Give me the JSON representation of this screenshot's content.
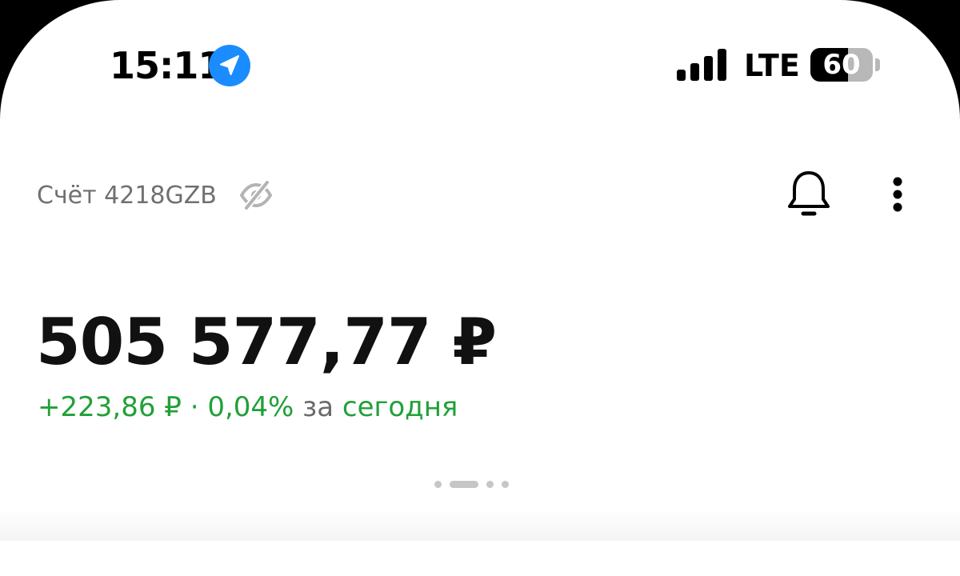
{
  "status_bar": {
    "time": "15:11",
    "network": "LTE",
    "battery_level": "60",
    "battery_fraction": 0.6,
    "location_icon": "location-arrow-icon",
    "signal_icon": "cellular-signal-icon"
  },
  "header": {
    "account_label": "Счёт 4218GZB",
    "eye_icon": "eye-off-icon",
    "bell_icon": "bell-icon",
    "more_icon": "more-vertical-icon"
  },
  "balance": {
    "amount": "505 577,77 ₽",
    "change_amount": "+223,86 ₽",
    "separator": "·",
    "change_percent": "0,04%",
    "period_prefix": "за",
    "period": "сегодня"
  },
  "page_indicator": {
    "pages": 4,
    "active_index": 1
  },
  "colors": {
    "positive": "#21a038",
    "secondary_text": "#707070",
    "location_badge": "#1a8cff"
  }
}
